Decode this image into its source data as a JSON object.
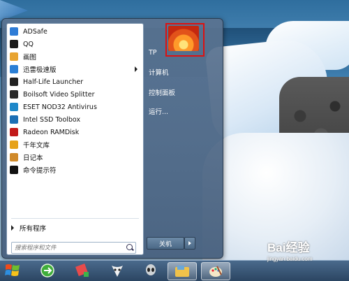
{
  "start_menu": {
    "programs": [
      {
        "label": "ADSafe",
        "icon": "adsafe-shield-icon",
        "color": "#2e7cd6"
      },
      {
        "label": "QQ",
        "icon": "qq-penguin-icon",
        "color": "#1a1a1a"
      },
      {
        "label": "画图",
        "icon": "paint-icon",
        "color": "#e8a431"
      },
      {
        "label": "迅雷极速版",
        "icon": "xunlei-icon",
        "color": "#2b7fd5",
        "submenu": true
      },
      {
        "label": "Half-Life Launcher",
        "icon": "half-life-icon",
        "color": "#222222"
      },
      {
        "label": "Boilsoft Video Splitter",
        "icon": "video-splitter-icon",
        "color": "#2a2a2a"
      },
      {
        "label": "ESET NOD32 Antivirus",
        "icon": "eset-icon",
        "color": "#1e88c9"
      },
      {
        "label": "Intel SSD Toolbox",
        "icon": "intel-icon",
        "color": "#1b6fb5"
      },
      {
        "label": "Radeon RAMDisk",
        "icon": "radeon-icon",
        "color": "#c21a1a"
      },
      {
        "label": "千年文库",
        "icon": "library-icon",
        "color": "#e6a21a"
      },
      {
        "label": "日记本",
        "icon": "diary-icon",
        "color": "#d08a2a"
      },
      {
        "label": "命令提示符",
        "icon": "cmd-icon",
        "color": "#111111"
      }
    ],
    "all_programs": "所有程序",
    "search_placeholder": "搜索程序和文件",
    "right_items": [
      {
        "label": "TP"
      },
      {
        "label": "计算机"
      },
      {
        "label": "控制面板"
      },
      {
        "label": "运行..."
      }
    ],
    "shutdown_label": "关机"
  },
  "watermark": {
    "main": "Bai经验",
    "sub": "jingyan.baidu.com"
  }
}
